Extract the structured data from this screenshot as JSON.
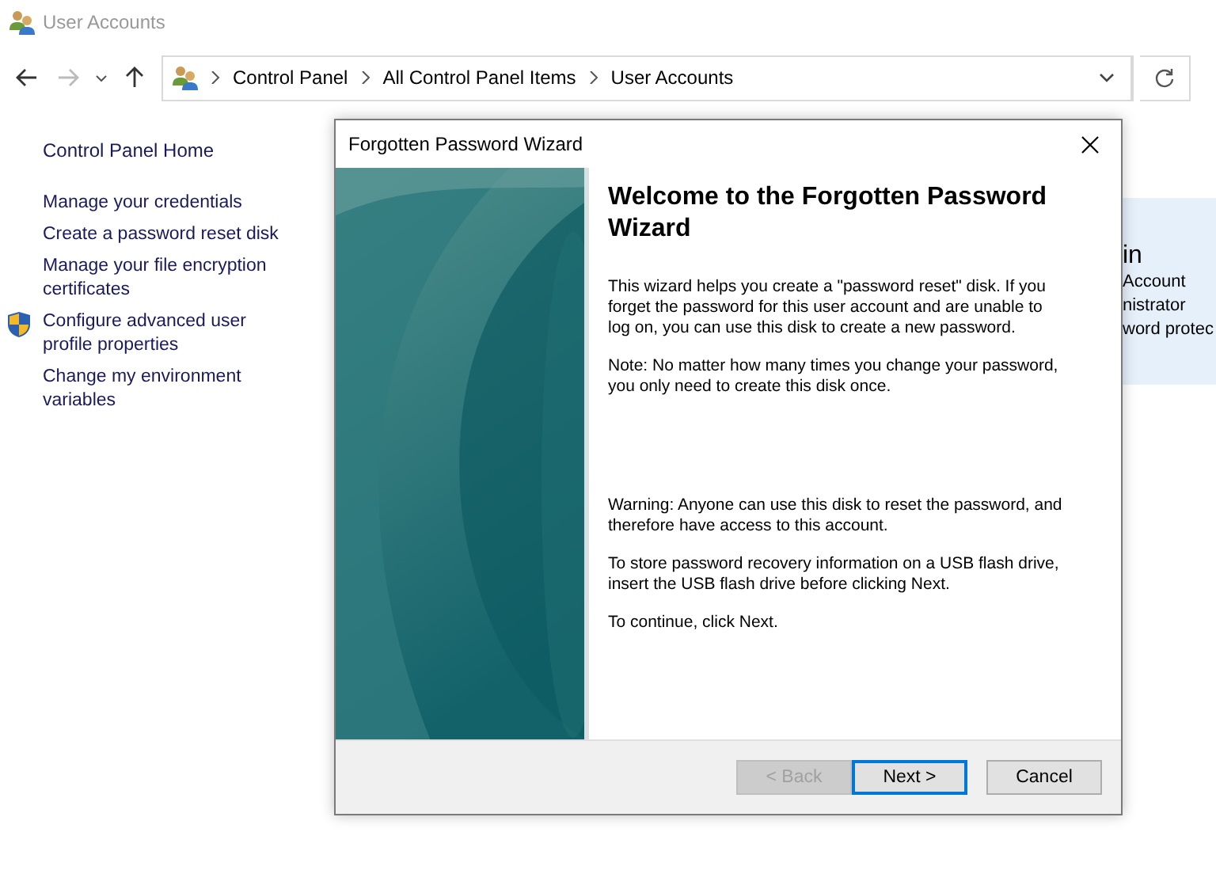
{
  "window": {
    "title": "User Accounts"
  },
  "address_bar": {
    "path": [
      "Control Panel",
      "All Control Panel Items",
      "User Accounts"
    ]
  },
  "sidebar": {
    "home": "Control Panel Home",
    "items": [
      {
        "label": "Manage your credentials",
        "shield": false
      },
      {
        "label": "Create a password reset disk",
        "shield": false
      },
      {
        "label": "Manage your file encryption certificates",
        "shield": false
      },
      {
        "label": "Configure advanced user profile properties",
        "shield": true
      },
      {
        "label": "Change my environment variables",
        "shield": false
      }
    ]
  },
  "account_panel": {
    "title": "in",
    "lines": [
      "Account",
      "nistrator",
      "word protec"
    ]
  },
  "dialog": {
    "title": "Forgotten Password Wizard",
    "heading": "Welcome to the Forgotten Password Wizard",
    "paragraphs": [
      "This wizard helps you create a \"password reset\" disk. If you forget the password for this user account and are unable to log on, you can use this disk to create a new password.",
      "Note: No matter how many times you change your password, you only need to create this disk once."
    ],
    "lower_paragraphs": [
      "Warning: Anyone can use this disk to reset the password, and therefore have access to this account.",
      "To store password recovery information on a USB flash drive, insert the USB flash drive before clicking Next.",
      "To continue, click Next."
    ],
    "buttons": [
      {
        "label": "< Back",
        "disabled": true,
        "default": false
      },
      {
        "label": "Next >",
        "disabled": false,
        "default": true
      },
      {
        "label": "Cancel",
        "disabled": false,
        "default": false
      }
    ]
  }
}
